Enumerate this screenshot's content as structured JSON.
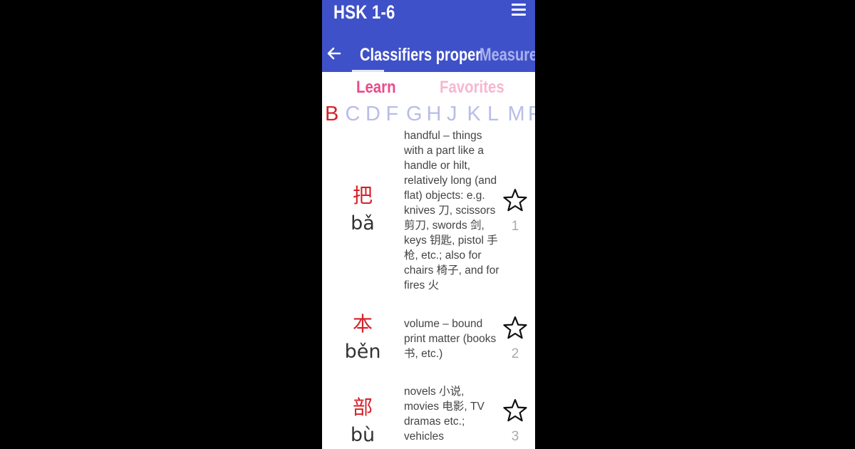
{
  "app_title": "HSK 1-6",
  "tabs": {
    "active": "Classifiers proper",
    "next": "Measure v"
  },
  "subtabs": {
    "learn": "Learn",
    "favorites": "Favorites"
  },
  "alphabet": [
    "B",
    "C",
    "D",
    "F",
    "G",
    "H",
    "J",
    "K",
    "L",
    "M",
    "P"
  ],
  "alphabet_active": "B",
  "icons": {
    "menu": "menu-icon",
    "back": "arrow-left-icon",
    "favorite": "star-outline-icon"
  },
  "colors": {
    "appbar": "#3f51c8",
    "accent_red": "#d42128",
    "learn_pink": "#ea4a8b",
    "favorites_pink": "#f6b7d0",
    "letter_inactive": "#b8bde8"
  },
  "entries": [
    {
      "hanzi": "把",
      "pinyin": "bǎ",
      "definition": "handful – things with a part like a handle or hilt, relatively long (and flat) objects: e.g. knives 刀, scissors 剪刀, swords 剑, keys 钥匙, pistol 手枪, etc.; also for chairs 椅子, and for fires 火",
      "number": "1"
    },
    {
      "hanzi": "本",
      "pinyin": "běn",
      "definition": "volume – bound print matter (books 书, etc.)",
      "number": "2"
    },
    {
      "hanzi": "部",
      "pinyin": "bù",
      "definition": "novels 小说, movies 电影, TV dramas etc.; vehicles",
      "number": "3"
    }
  ]
}
